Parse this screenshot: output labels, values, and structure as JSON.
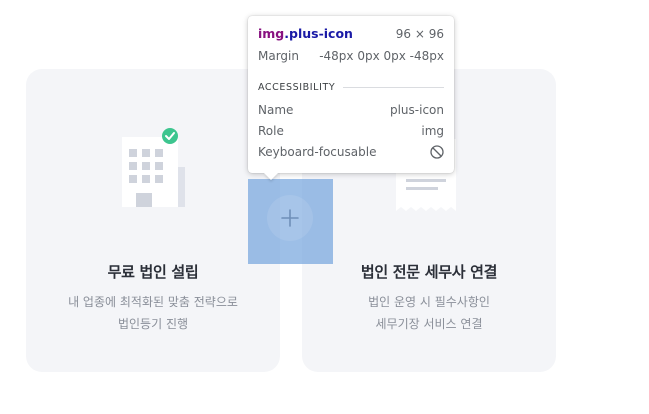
{
  "cards": [
    {
      "title": "무료 법인 설립",
      "description": [
        "내 업종에 최적화된 맞춤 전략으로",
        "법인등기 진행"
      ],
      "icon": "building-check-icon"
    },
    {
      "title": "법인 전문 세무사 연결",
      "description": [
        "법인 운영 시 필수사항인",
        "세무기장 서비스 연결"
      ],
      "icon": "receipt-icon"
    }
  ],
  "plus": {
    "icon": "plus-icon"
  },
  "inspector": {
    "tag": "img",
    "class_name": ".plus-icon",
    "size": "96 × 96",
    "margin_label": "Margin",
    "margin_value": "-48px 0px 0px -48px",
    "section_title": "ACCESSIBILITY",
    "name_label": "Name",
    "name_value": "plus-icon",
    "role_label": "Role",
    "role_value": "img",
    "focus_label": "Keyboard-focusable",
    "focus_icon": "not-allowed-icon"
  },
  "colors": {
    "card_bg": "#f4f5f8",
    "check_green": "#3dc58f",
    "overlay_blue": "#6fa1dc",
    "tag_purple": "#881280",
    "class_blue": "#1a1aa6"
  }
}
